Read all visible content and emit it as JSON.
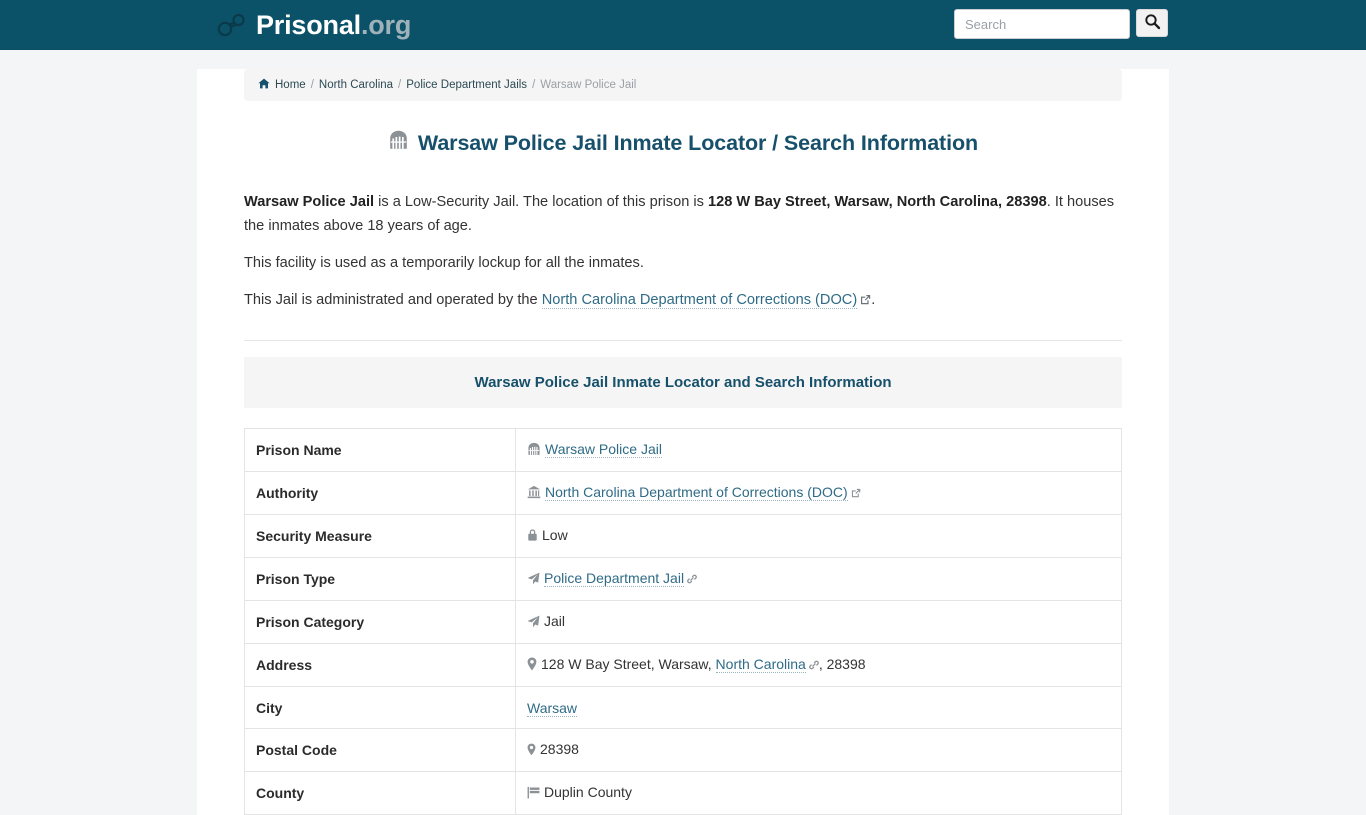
{
  "site": {
    "brand_name": "Prisonal",
    "brand_tld": ".org",
    "logo_icon": "handcuffs-icon"
  },
  "search": {
    "placeholder": "Search",
    "value": "",
    "button_icon": "search-icon"
  },
  "breadcrumb": {
    "home_icon": "home-icon",
    "items": [
      {
        "label": "Home",
        "current": false
      },
      {
        "label": "North Carolina",
        "current": false
      },
      {
        "label": "Police Department Jails",
        "current": false
      },
      {
        "label": "Warsaw Police Jail",
        "current": true
      }
    ],
    "separator": "/"
  },
  "page": {
    "title": "Warsaw Police Jail Inmate Locator / Search Information",
    "title_icon": "jail-building-icon",
    "paragraphs": {
      "p1_a": "Warsaw Police Jail",
      "p1_b": " is a Low-Security Jail. The location of this prison is ",
      "p1_c": "128 W Bay Street, Warsaw, North Carolina, 28398",
      "p1_d": ". It houses the inmates above 18 years of age.",
      "p2": "This facility is used as a temporarily lockup for all the inmates.",
      "p3_a": "This Jail is administrated and operated by the ",
      "p3_link": "North Carolina Department of Corrections (DOC)",
      "p3_b": "."
    }
  },
  "table": {
    "caption": "Warsaw Police Jail Inmate Locator and Search Information",
    "rows": [
      {
        "key": "Prison Name",
        "value": "Warsaw Police Jail",
        "icon": "jail-building-icon",
        "link": true,
        "external": false,
        "chain": false
      },
      {
        "key": "Authority",
        "value": "North Carolina Department of Corrections (DOC)",
        "icon": "bank-institution-icon",
        "link": true,
        "external": true,
        "chain": false
      },
      {
        "key": "Security Measure",
        "value": "Low",
        "icon": "lock-icon",
        "link": false,
        "external": false,
        "chain": false
      },
      {
        "key": "Prison Type",
        "value": "Police Department Jail",
        "icon": "paper-plane-icon",
        "link": true,
        "external": false,
        "chain": true
      },
      {
        "key": "Prison Category",
        "value": "Jail",
        "icon": "paper-plane-icon",
        "link": false,
        "external": false,
        "chain": false
      },
      {
        "key": "Address",
        "value_prefix": "128 W Bay Street, Warsaw, ",
        "value_link": "North Carolina",
        "value_suffix": ", 28398",
        "icon": "map-pin-icon",
        "link": false,
        "external": false,
        "chain": true
      },
      {
        "key": "City",
        "value": "Warsaw",
        "icon": "none",
        "link": true,
        "external": false,
        "chain": false
      },
      {
        "key": "Postal Code",
        "value": "28398",
        "icon": "map-pin-icon",
        "link": false,
        "external": false,
        "chain": false
      },
      {
        "key": "County",
        "value": "Duplin County",
        "icon": "flag-icon",
        "link": false,
        "external": false,
        "chain": false
      }
    ]
  },
  "colors": {
    "header_bg": "#0b5269",
    "heading": "#17506b",
    "link": "#2f6b86",
    "page_bg": "#f4f5f7",
    "panel_bg": "#f5f5f5"
  }
}
